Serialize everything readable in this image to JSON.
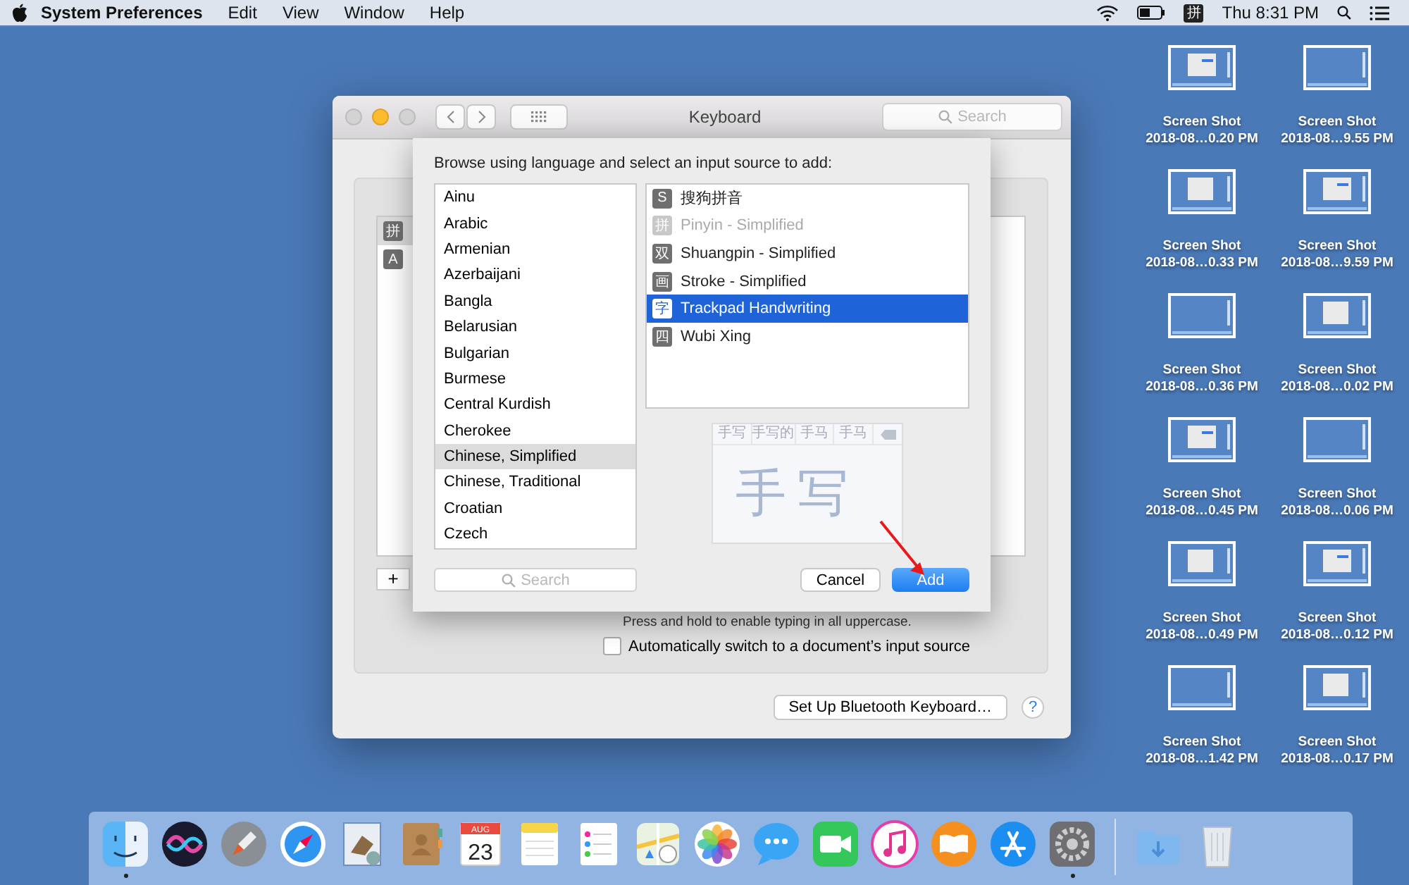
{
  "menu_bar": {
    "app_name": "System Preferences",
    "menus": [
      "Edit",
      "View",
      "Window",
      "Help"
    ],
    "input_source": "拼",
    "clock": "Thu 8:31 PM"
  },
  "window": {
    "title": "Keyboard",
    "search_placeholder": "Search",
    "sources": [
      {
        "glyph": "拼",
        "selected": true
      },
      {
        "glyph": "A",
        "selected": false
      }
    ],
    "add_button": "+",
    "caps_note": "Press and hold to enable typing in all uppercase.",
    "auto_switch": {
      "label": "Automatically switch to a document’s input source",
      "checked": false
    },
    "bluetooth_button": "Set Up Bluetooth Keyboard…",
    "help_button": "?"
  },
  "sheet": {
    "prompt": "Browse using language and select an input source to add:",
    "languages": [
      {
        "name": "Ainu",
        "selected": false
      },
      {
        "name": "Arabic",
        "selected": false
      },
      {
        "name": "Armenian",
        "selected": false
      },
      {
        "name": "Azerbaijani",
        "selected": false
      },
      {
        "name": "Bangla",
        "selected": false
      },
      {
        "name": "Belarusian",
        "selected": false
      },
      {
        "name": "Bulgarian",
        "selected": false
      },
      {
        "name": "Burmese",
        "selected": false
      },
      {
        "name": "Central Kurdish",
        "selected": false
      },
      {
        "name": "Cherokee",
        "selected": false
      },
      {
        "name": "Chinese, Simplified",
        "selected": true
      },
      {
        "name": "Chinese, Traditional",
        "selected": false
      },
      {
        "name": "Croatian",
        "selected": false
      },
      {
        "name": "Czech",
        "selected": false
      }
    ],
    "input_sources": [
      {
        "glyph": "S",
        "name": "搜狗拼音",
        "disabled": false,
        "selected": false
      },
      {
        "glyph": "拼",
        "name": "Pinyin - Simplified",
        "disabled": true,
        "selected": false
      },
      {
        "glyph": "双",
        "name": "Shuangpin - Simplified",
        "disabled": false,
        "selected": false
      },
      {
        "glyph": "画",
        "name": "Stroke - Simplified",
        "disabled": false,
        "selected": false
      },
      {
        "glyph": "字",
        "name": "Trackpad Handwriting",
        "disabled": false,
        "selected": true
      },
      {
        "glyph": "四",
        "name": "Wubi Xing",
        "disabled": false,
        "selected": false
      }
    ],
    "preview": {
      "candidates": [
        "手写",
        "手写的",
        "手马",
        "手马"
      ],
      "handwriting": "手写"
    },
    "search_placeholder": "Search",
    "cancel_button": "Cancel",
    "add_button": "Add"
  },
  "desktop": {
    "files": [
      {
        "title": "Screen Shot",
        "subtitle": "2018-08…0.20 PM"
      },
      {
        "title": "Screen Shot",
        "subtitle": "2018-08…9.55 PM"
      },
      {
        "title": "Screen Shot",
        "subtitle": "2018-08…0.33 PM"
      },
      {
        "title": "Screen Shot",
        "subtitle": "2018-08…9.59 PM"
      },
      {
        "title": "Screen Shot",
        "subtitle": "2018-08…0.36 PM"
      },
      {
        "title": "Screen Shot",
        "subtitle": "2018-08…0.02 PM"
      },
      {
        "title": "Screen Shot",
        "subtitle": "2018-08…0.45 PM"
      },
      {
        "title": "Screen Shot",
        "subtitle": "2018-08…0.06 PM"
      },
      {
        "title": "Screen Shot",
        "subtitle": "2018-08…0.49 PM"
      },
      {
        "title": "Screen Shot",
        "subtitle": "2018-08…0.12 PM"
      },
      {
        "title": "Screen Shot",
        "subtitle": "2018-08…1.42 PM"
      },
      {
        "title": "Screen Shot",
        "subtitle": "2018-08…0.17 PM"
      }
    ]
  },
  "dock": {
    "apps": [
      {
        "kind": "finder",
        "running": true
      },
      {
        "kind": "siri",
        "running": false
      },
      {
        "kind": "launchpad",
        "running": false
      },
      {
        "kind": "safari",
        "running": false
      },
      {
        "kind": "mail",
        "running": false
      },
      {
        "kind": "contacts",
        "running": false
      },
      {
        "kind": "calendar",
        "running": false,
        "month": "AUG",
        "day": "23"
      },
      {
        "kind": "notes",
        "running": false
      },
      {
        "kind": "reminders",
        "running": false
      },
      {
        "kind": "maps",
        "running": false
      },
      {
        "kind": "photos",
        "running": false
      },
      {
        "kind": "messages",
        "running": false
      },
      {
        "kind": "facetime",
        "running": false
      },
      {
        "kind": "music",
        "running": false
      },
      {
        "kind": "books",
        "running": false
      },
      {
        "kind": "appstore",
        "running": false
      },
      {
        "kind": "settings",
        "running": true
      }
    ],
    "stacks": [
      {
        "kind": "downloads"
      },
      {
        "kind": "trash"
      }
    ]
  }
}
